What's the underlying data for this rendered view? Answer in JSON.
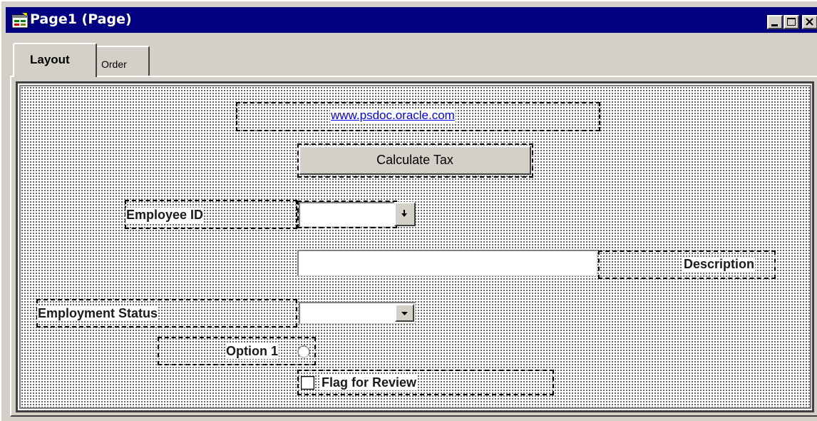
{
  "window": {
    "title": "Page1 (Page)",
    "controls": [
      "minimize-icon",
      "maximize-icon",
      "close-icon"
    ]
  },
  "tabs": [
    {
      "label": "Layout",
      "active": true
    },
    {
      "label": "Order",
      "active": false
    }
  ],
  "canvas": {
    "link": {
      "text": "www.psdoc.oracle.com",
      "color": "#0000ff"
    },
    "button": {
      "label": "Calculate Tax"
    },
    "employee_id": {
      "label": "Employee ID",
      "value": "",
      "dropdown_icon": "arrow-down-small-icon"
    },
    "description": {
      "label": "Description",
      "value": ""
    },
    "employment_status": {
      "label": "Employment Status",
      "value": "",
      "dropdown_icon": "chevron-down-icon"
    },
    "option": {
      "label": "Option 1",
      "selected": false
    },
    "checkbox": {
      "label": "Flag for Review",
      "checked": false
    }
  },
  "colors": {
    "titlebar": "#000080",
    "face": "#d4d0c8",
    "link": "#0000ff"
  }
}
